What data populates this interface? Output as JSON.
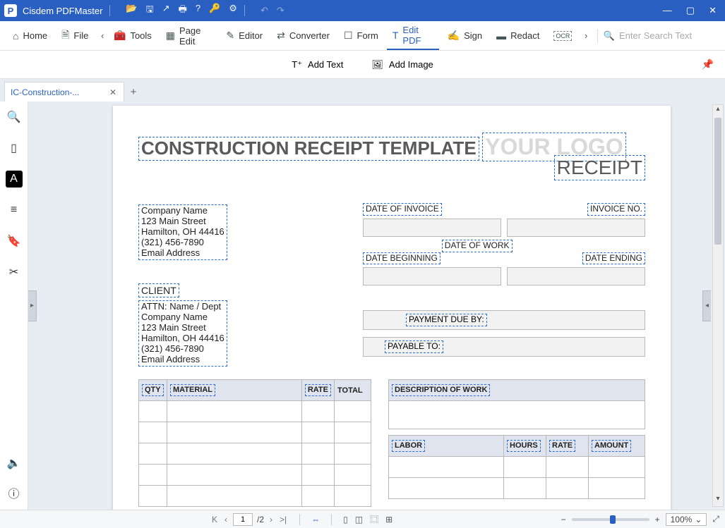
{
  "app": {
    "logo_letter": "P",
    "name": "Cisdem PDFMaster"
  },
  "title_icons": {
    "open": "📂",
    "save": "🖫",
    "share": "↗",
    "print": "🖶",
    "help": "?",
    "key": "🔑",
    "settings": "⚙",
    "undo": "↶",
    "redo": "↷"
  },
  "window": {
    "min": "—",
    "max": "▢",
    "close": "✕"
  },
  "tools": {
    "home": "Home",
    "file": "File",
    "tools": "Tools",
    "page_edit": "Page Edit",
    "editor": "Editor",
    "converter": "Converter",
    "form": "Form",
    "edit_pdf": "Edit PDF",
    "sign": "Sign",
    "redact": "Redact",
    "prev": "‹",
    "next": "›",
    "ocr": "OCR",
    "search_icon": "🔍",
    "search_placeholder": "Enter Search Text"
  },
  "subbar": {
    "add_text": "Add Text",
    "add_image": "Add Image",
    "pin": "📌"
  },
  "tab": {
    "name": "IC-Construction-...",
    "close": "✕",
    "new": "+"
  },
  "sidebar": {
    "search": "🔍",
    "thumbs": "▯",
    "text": "A",
    "list": "≡",
    "bookmark": "🔖",
    "snip": "✂",
    "sound": "🔈",
    "info": "ⓘ"
  },
  "edge": {
    "left": "▸",
    "right": "◂"
  },
  "doc": {
    "title": "CONSTRUCTION RECEIPT TEMPLATE",
    "logo": "YOUR LOGO",
    "receipt": "RECEIPT",
    "company": {
      "l1": "Company Name",
      "l2": "123 Main Street",
      "l3": "Hamilton, OH  44416",
      "l4": "(321) 456-7890",
      "l5": "Email Address"
    },
    "client_header": "CLIENT",
    "client": {
      "l1": "ATTN: Name / Dept",
      "l2": "Company Name",
      "l3": "123 Main Street",
      "l4": "Hamilton, OH  44416",
      "l5": "(321) 456-7890",
      "l6": "Email Address"
    },
    "labels": {
      "date_invoice": "DATE OF INVOICE",
      "invoice_no": "INVOICE NO.",
      "date_work": "DATE OF WORK",
      "date_begin": "DATE BEGINNING",
      "date_end": "DATE ENDING",
      "payment_due": "PAYMENT DUE BY:",
      "payable_to": "PAYABLE TO:"
    },
    "table_left": {
      "h1": "QTY",
      "h2": "MATERIAL",
      "h3": "RATE",
      "h4": "TOTAL"
    },
    "table_right": {
      "desc": "DESCRIPTION OF WORK",
      "h1": "LABOR",
      "h2": "HOURS",
      "h3": "RATE",
      "h4": "AMOUNT"
    }
  },
  "status": {
    "first": "K",
    "prev": "‹",
    "page": "1",
    "total": "/2",
    "next": "›",
    "last": ">|",
    "fit1": "⇔",
    "fit2": "▯",
    "fit3": "◫",
    "fit4": "⿴",
    "fit5": "⊞",
    "zoom_out": "−",
    "zoom_in": "+",
    "zoom": "100%",
    "dd": "⌄",
    "full": "⤢"
  }
}
